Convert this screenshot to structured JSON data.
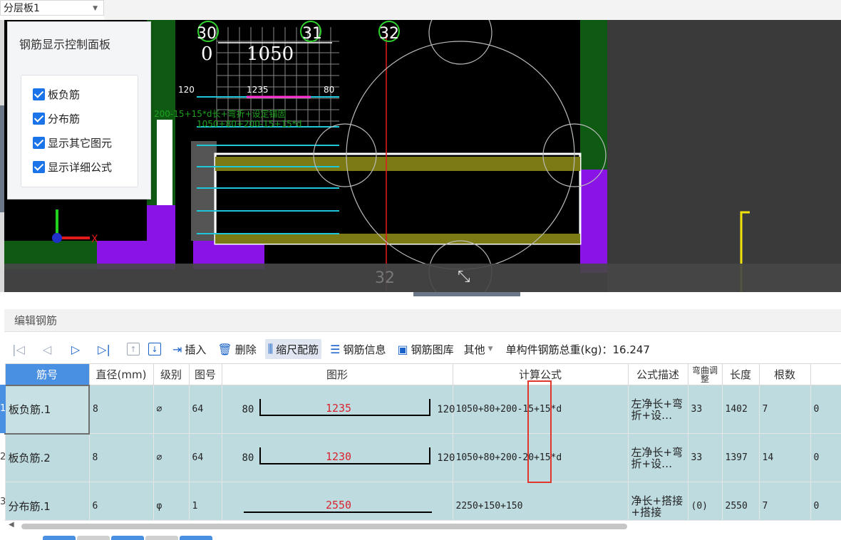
{
  "layer_select": {
    "value": "分层板1"
  },
  "control_panel": {
    "title": "钢筋显示控制面板",
    "options": [
      {
        "label": "板负筋",
        "checked": true
      },
      {
        "label": "分布筋",
        "checked": true
      },
      {
        "label": "显示其它图元",
        "checked": true
      },
      {
        "label": "显示详细公式",
        "checked": true
      }
    ]
  },
  "viewport": {
    "grid_labels": [
      "30",
      "31",
      "32"
    ],
    "dim_1050": "1050",
    "dim_0": "0",
    "rebar_120": "120",
    "rebar_1235": "1235",
    "rebar_80": "80",
    "green_formula_1": "200-15+15*d长+弯折+设定锚固",
    "green_formula_2": "1050+80+200-15+15*d",
    "axis_x": "X",
    "band_number": "32"
  },
  "editor": {
    "title": "编辑钢筋",
    "toolbar": {
      "insert": "插入",
      "delete": "删除",
      "scale_rebar": "缩尺配筋",
      "rebar_info": "钢筋信息",
      "rebar_library": "钢筋图库",
      "other": "其他",
      "total_weight": "单构件钢筋总重(kg)：16.247"
    },
    "columns": [
      "筋号",
      "直径(mm)",
      "级别",
      "图号",
      "图形",
      "计算公式",
      "公式描述",
      "弯曲调整",
      "长度",
      "根数",
      ""
    ],
    "rows": [
      {
        "idx": "1",
        "name": "板负筋.1",
        "dia": "8",
        "grade": "⌀",
        "fig": "64",
        "left": "80",
        "mid": "1235",
        "right": "120",
        "formula": "1050+80+200-15+15*d",
        "desc": "左净长+弯折+设…",
        "bend": "33",
        "length": "1402",
        "count": "7",
        "extra": "0"
      },
      {
        "idx": "2",
        "name": "板负筋.2",
        "dia": "8",
        "grade": "⌀",
        "fig": "64",
        "left": "80",
        "mid": "1230",
        "right": "120",
        "formula": "1050+80+200-20+15*d",
        "desc": "左净长+弯折+设…",
        "bend": "33",
        "length": "1397",
        "count": "14",
        "extra": "0"
      },
      {
        "idx": "3",
        "name": "分布筋.1",
        "dia": "6",
        "grade": "φ",
        "fig": "1",
        "left": "",
        "mid": "2550",
        "right": "",
        "formula": "2250+150+150",
        "desc": "净长+搭接+搭接",
        "bend": "(0)",
        "length": "2550",
        "count": "7",
        "extra": "0"
      }
    ]
  },
  "colors": {
    "accent": "#4a90e2",
    "row_bg": "#bedbe0",
    "highlight_box": "#e0362c"
  }
}
